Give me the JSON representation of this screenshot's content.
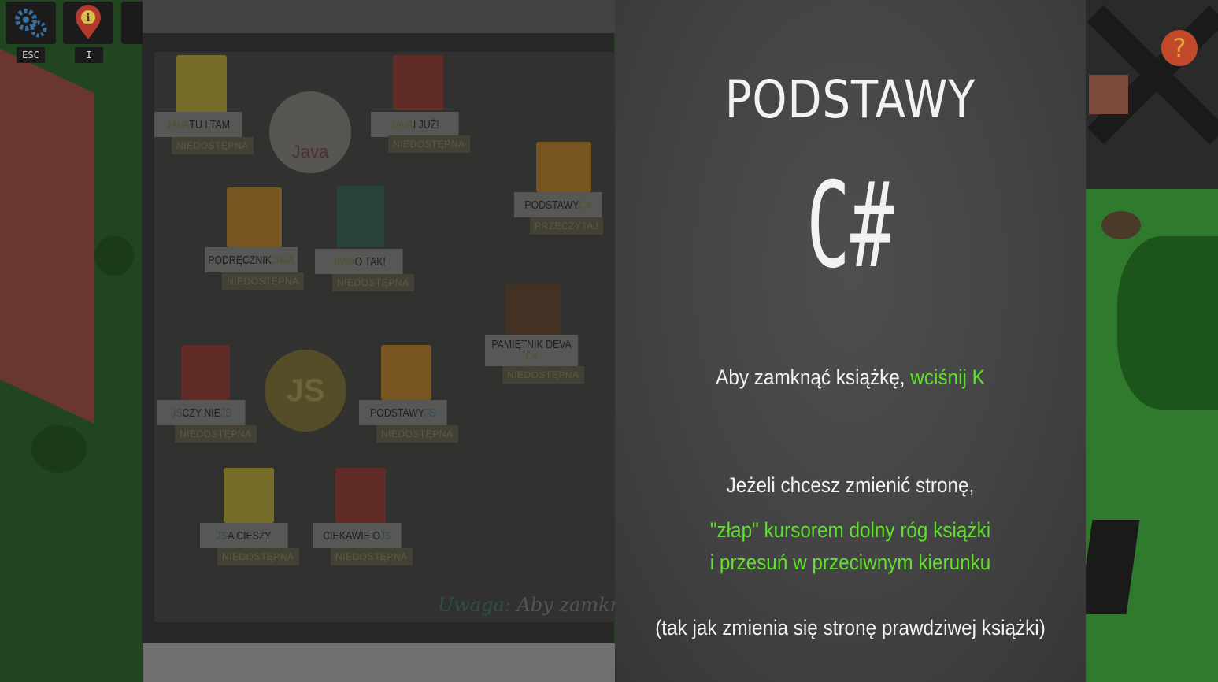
{
  "hud": {
    "buttons": [
      {
        "icon": "gear-icon",
        "key": "ESC"
      },
      {
        "icon": "info-pin-icon",
        "key": "I"
      }
    ]
  },
  "library": {
    "books": [
      {
        "title_parts": [
          "JAVA",
          " TU I TAM"
        ],
        "status": "NIEDOSTĘPNA",
        "cover": "#c9b63c"
      },
      {
        "title_parts": [
          "JAVA",
          " I JUŻ!"
        ],
        "status": "NIEDOSTĘPNA",
        "cover": "#a04038"
      },
      {
        "title_parts": [
          "PODSTAWY ",
          "C#"
        ],
        "status": "PRZECZYTAJ",
        "cover": "#c98a2c"
      },
      {
        "title_parts": [
          "PODRĘCZNIK ",
          "JAVA"
        ],
        "status": "NIEDOSTĘPNA",
        "cover": "#c98a2c"
      },
      {
        "title_parts": [
          "JAVA",
          " O TAK!"
        ],
        "status": "NIEDOSTĘPNA",
        "cover": "#3a6a58"
      },
      {
        "title_parts": [
          "PAMIĘTNIK DEVA",
          "C#"
        ],
        "status": "NIEDOSTĘPNA",
        "cover": "#6a4a30"
      },
      {
        "title_parts": [
          "JS",
          " CZY NIE ",
          "JS"
        ],
        "status": "NIEDOSTĘPNA",
        "cover": "#a04038"
      },
      {
        "title_parts": [
          "PODSTAWY ",
          "JS"
        ],
        "status": "NIEDOSTĘPNA",
        "cover": "#c98a2c"
      },
      {
        "title_parts": [
          "JS",
          " A CIESZY"
        ],
        "status": "NIEDOSTĘPNA",
        "cover": "#c9b63c"
      },
      {
        "title_parts": [
          "CIEKAWIE O ",
          "JS"
        ],
        "status": "NIEDOSTĘPNA",
        "cover": "#a04038"
      }
    ],
    "logos": [
      {
        "name": "java",
        "label": "Java"
      },
      {
        "name": "js",
        "label": "JS"
      }
    ],
    "note_prefix": "Uwaga:",
    "note_text": " Aby zamkną"
  },
  "book": {
    "title": "PODSTAWY",
    "language": "C#",
    "close_hint_text": "Aby zamknąć książkę, ",
    "close_hint_key": "wciśnij K",
    "page_hint_line1": "Jeżeli chcesz zmienić stronę,",
    "page_hint_line2": "\"złap\" kursorem dolny róg książki",
    "page_hint_line3": "i przesuń w przeciwnym kierunku",
    "page_hint_line4": "(tak jak zmienia się stronę prawdziwej książki)"
  },
  "colors": {
    "accent_green": "#5ee12a",
    "chalkboard": "#444444"
  }
}
